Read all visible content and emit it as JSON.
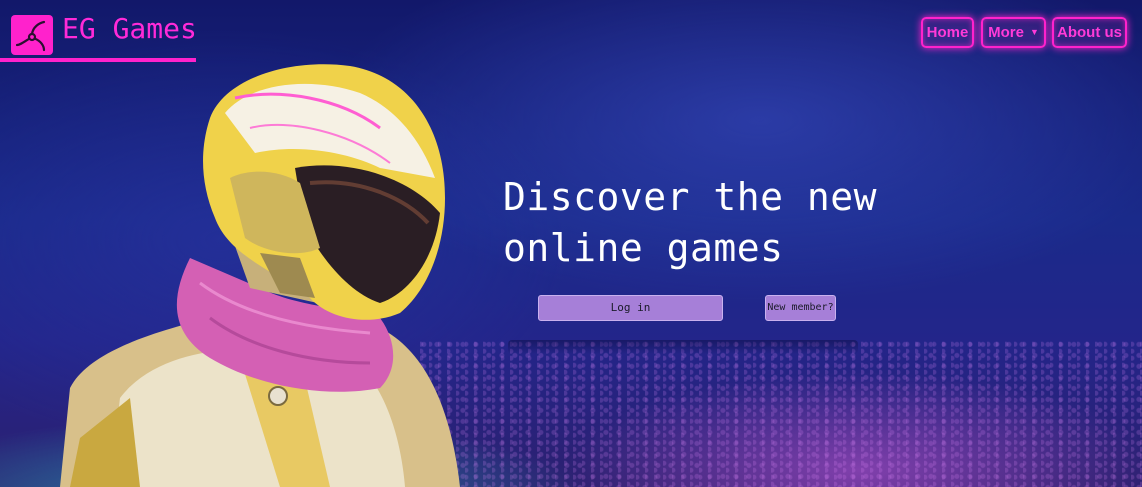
{
  "brand": {
    "name": "EG Games",
    "logo_icon": "propeller-logo-icon",
    "accent": "#ff22cc"
  },
  "nav": {
    "home": "Home",
    "more": "More",
    "about": "About us"
  },
  "hero": {
    "title_line1": "Discover the new",
    "title_line2": "online games",
    "login_label": "Log in",
    "new_member_label": "New member?",
    "button_color": "#a67fd8"
  },
  "background": {
    "colors": [
      "#12186a",
      "#2c2070",
      "#28d2d2",
      "#c85adc"
    ]
  }
}
